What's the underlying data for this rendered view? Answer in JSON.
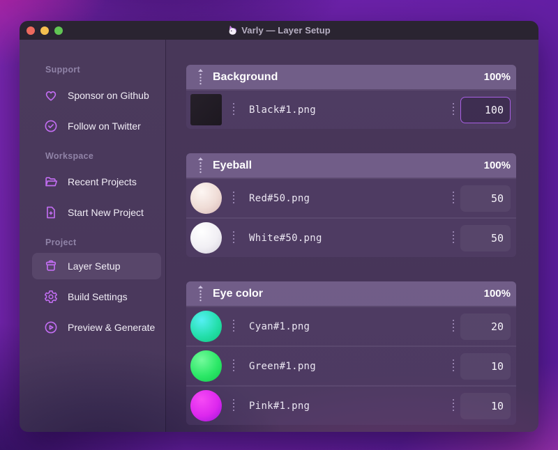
{
  "titlebar": {
    "app_icon": "unicorn-emoji",
    "title": "Varly — Layer Setup"
  },
  "sidebar": {
    "sections": [
      {
        "label": "Support",
        "items": [
          {
            "icon": "heart-icon",
            "label": "Sponsor on Github"
          },
          {
            "icon": "check-badge-icon",
            "label": "Follow on Twitter"
          }
        ]
      },
      {
        "label": "Workspace",
        "items": [
          {
            "icon": "folder-open-icon",
            "label": "Recent Projects"
          },
          {
            "icon": "file-plus-icon",
            "label": "Start New Project"
          }
        ]
      },
      {
        "label": "Project",
        "items": [
          {
            "icon": "archive-box-icon",
            "label": "Layer Setup",
            "active": true
          },
          {
            "icon": "gear-icon",
            "label": "Build Settings"
          },
          {
            "icon": "play-circle-icon",
            "label": "Preview & Generate"
          }
        ]
      }
    ]
  },
  "layers": {
    "groups": [
      {
        "name": "Background",
        "opacity": "100%",
        "rows": [
          {
            "file": "Black#1.png",
            "value": "100",
            "focused": true,
            "thumb": {
              "type": "square",
              "colors": [
                "#26202a",
                "#221c25",
                "#1d1820"
              ]
            }
          }
        ]
      },
      {
        "name": "Eyeball",
        "opacity": "100%",
        "rows": [
          {
            "file": "Red#50.png",
            "value": "50",
            "focused": false,
            "thumb": {
              "type": "sphere",
              "colors": [
                "#fdf6f3",
                "#efdcd6",
                "#d6b6b4"
              ]
            }
          },
          {
            "file": "White#50.png",
            "value": "50",
            "focused": false,
            "thumb": {
              "type": "sphere",
              "colors": [
                "#ffffff",
                "#f1eff4",
                "#d2cdd9"
              ]
            }
          }
        ]
      },
      {
        "name": "Eye color",
        "opacity": "100%",
        "rows": [
          {
            "file": "Cyan#1.png",
            "value": "20",
            "focused": false,
            "thumb": {
              "type": "sphere",
              "colors": [
                "#55eff4",
                "#24dfab",
                "#0fc77c"
              ]
            }
          },
          {
            "file": "Green#1.png",
            "value": "10",
            "focused": false,
            "thumb": {
              "type": "sphere",
              "colors": [
                "#74fa9c",
                "#2ce867",
                "#10c94d"
              ]
            }
          },
          {
            "file": "Pink#1.png",
            "value": "10",
            "focused": false,
            "thumb": {
              "type": "sphere",
              "colors": [
                "#f64af5",
                "#dd28ee",
                "#9a14d8"
              ]
            }
          }
        ]
      }
    ]
  },
  "colors": {
    "accent": "#c26df2",
    "focus_border": "#a85fe3",
    "traffic_lights": [
      "#ed6a5e",
      "#f5bf4f",
      "#61c554"
    ]
  }
}
